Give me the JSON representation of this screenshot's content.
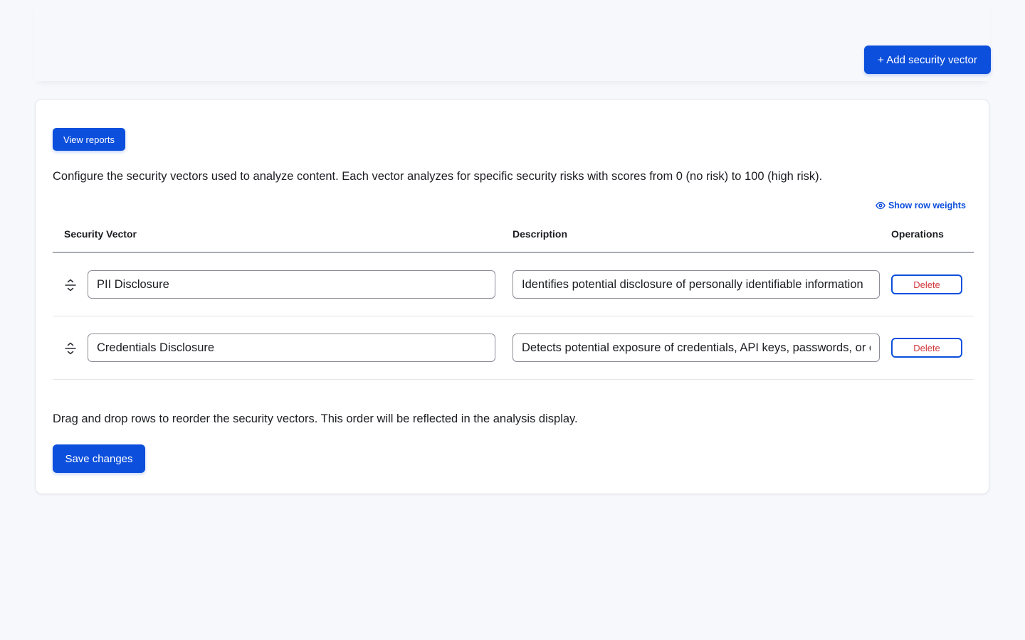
{
  "header": {
    "add_button_label": "+ Add security vector"
  },
  "card": {
    "view_reports_label": "View reports",
    "intro_text": "Configure the security vectors used to analyze content. Each vector analyzes for specific security risks with scores from 0 (no risk) to 100 (high risk).",
    "show_weights_label": "Show row weights",
    "table": {
      "headers": {
        "vector": "Security Vector",
        "description": "Description",
        "operations": "Operations"
      },
      "rows": [
        {
          "name": "PII Disclosure",
          "description": "Identifies potential disclosure of personally identifiable information",
          "delete_label": "Delete"
        },
        {
          "name": "Credentials Disclosure",
          "description": "Detects potential exposure of credentials, API keys, passwords, or other secrets",
          "delete_label": "Delete"
        }
      ]
    },
    "hint_text": "Drag and drop rows to reorder the security vectors. This order will be reflected in the analysis display.",
    "save_label": "Save changes"
  },
  "icons": {
    "show_weights": "eye-icon",
    "drag_handle": "drag-handle-icon"
  },
  "colors": {
    "primary": "#0c4fdc",
    "danger_text": "#d0363a",
    "page_background": "#f7f8fc",
    "card_background": "#ffffff"
  }
}
